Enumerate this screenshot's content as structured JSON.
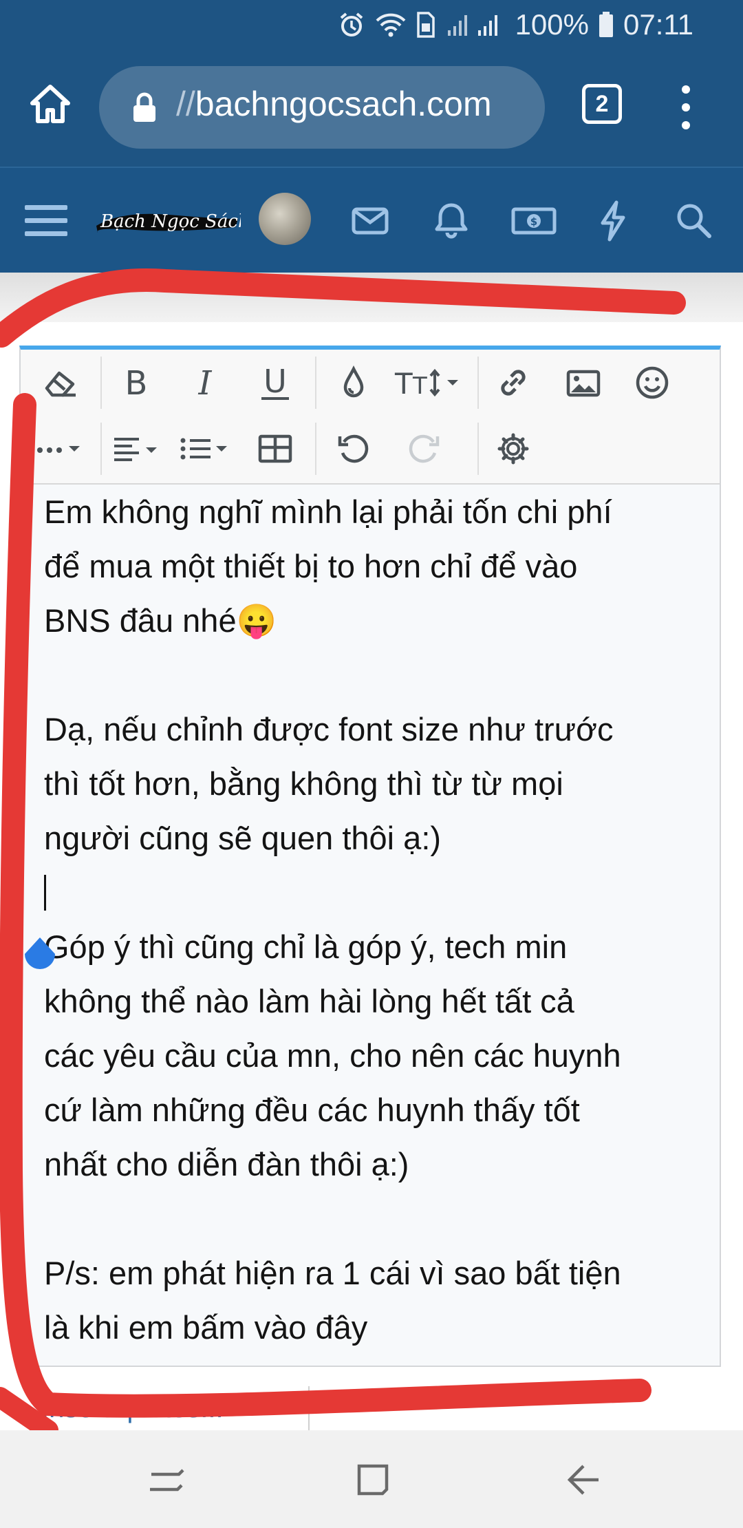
{
  "status_bar": {
    "battery": "100%",
    "time": "07:11"
  },
  "browser": {
    "url_prefix": "//",
    "url_domain": "bachngocsach.com",
    "tab_count": "2"
  },
  "site_nav": {
    "logo_text": "Bạch Ngọc Sách"
  },
  "editor": {
    "paragraphs": [
      "Em không nghĩ mình lại phải tốn chi phí",
      "để mua một thiết bị to hơn chỉ để vào",
      "BNS đâu nhé",
      "",
      "Dạ, nếu chỉnh được font size như trước",
      "thì tốt hơn, bằng không thì từ từ mọi",
      "người cũng sẽ quen thôi ạ:)",
      "",
      "Góp ý thì cũng chỉ là góp ý, tech min",
      "không thể nào làm hài lòng hết tất cả",
      "các yêu cầu của mn, cho nên các huynh",
      "cứ làm những đều các huynh thấy tốt",
      "nhất cho diễn đàn thôi ạ:)",
      "",
      "P/s: em phát hiện ra 1 cái vì sao bất tiện",
      "là khi em bấm vào đây"
    ],
    "emoji": "😛"
  },
  "below_editor": {
    "insert_quotes": "Insert quotes..."
  },
  "colors": {
    "header_blue": "#1c5587",
    "url_box": "#4a7499",
    "editor_accent": "#47a7eb",
    "markup_red": "#e53935"
  }
}
